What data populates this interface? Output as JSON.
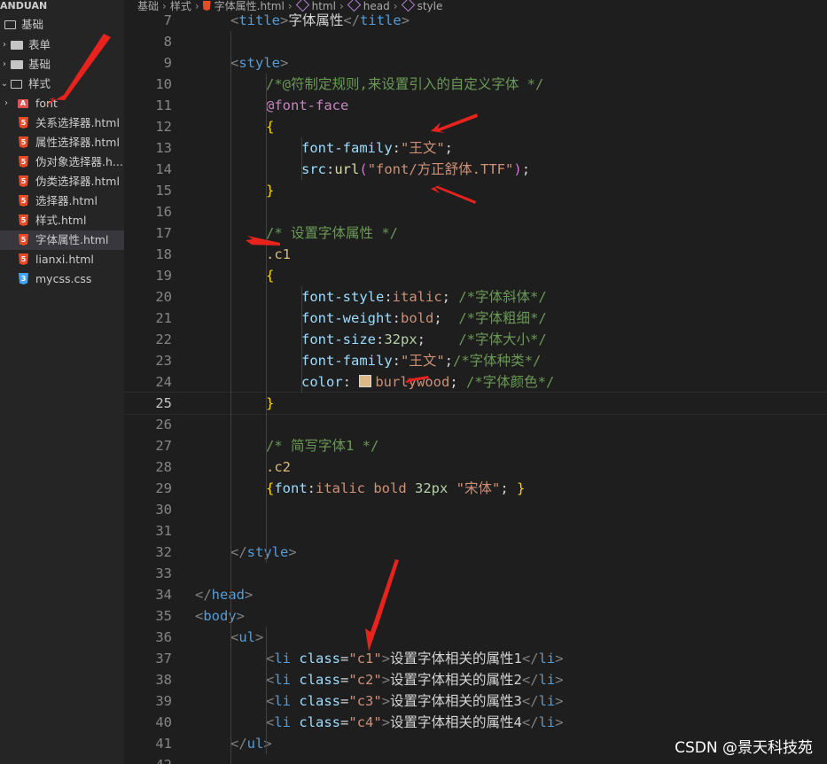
{
  "explorer": {
    "header": "ANDUAN",
    "items": [
      {
        "label": "基础",
        "kind": "folder-open",
        "indent": 0
      },
      {
        "label": "表单",
        "kind": "folder",
        "indent": 1
      },
      {
        "label": "基础",
        "kind": "folder",
        "indent": 1
      },
      {
        "label": "样式",
        "kind": "folder-open",
        "indent": 1
      },
      {
        "label": "font",
        "kind": "folder-font",
        "indent": 2
      },
      {
        "label": "关系选择器.html",
        "kind": "html",
        "indent": 2
      },
      {
        "label": "属性选择器.html",
        "kind": "html",
        "indent": 2
      },
      {
        "label": "伪对象选择器.h...",
        "kind": "html",
        "indent": 2
      },
      {
        "label": "伪类选择器.html",
        "kind": "html",
        "indent": 2
      },
      {
        "label": "选择器.html",
        "kind": "html",
        "indent": 2
      },
      {
        "label": "样式.html",
        "kind": "html",
        "indent": 2
      },
      {
        "label": "字体属性.html",
        "kind": "html",
        "indent": 2,
        "active": true
      },
      {
        "label": "lianxi.html",
        "kind": "html",
        "indent": 2
      },
      {
        "label": "mycss.css",
        "kind": "css",
        "indent": 2
      }
    ]
  },
  "breadcrumb": [
    "基础",
    "样式",
    "字体属性.html",
    "html",
    "head",
    "style"
  ],
  "editor": {
    "current_line": 25,
    "lines": [
      {
        "n": "7",
        "ind": 1,
        "t": [
          [
            "br",
            "<"
          ],
          [
            "tag",
            "title"
          ],
          [
            "br",
            ">"
          ],
          [
            "txt",
            "字体属性"
          ],
          [
            "br",
            "</"
          ],
          [
            "tag",
            "title"
          ],
          [
            "br",
            ">"
          ]
        ]
      },
      {
        "n": "8",
        "ind": 0,
        "t": []
      },
      {
        "n": "9",
        "ind": 1,
        "t": [
          [
            "br",
            "<"
          ],
          [
            "tag",
            "style"
          ],
          [
            "br",
            ">"
          ]
        ]
      },
      {
        "n": "10",
        "ind": 2,
        "t": [
          [
            "cm",
            "/*@符制定规则,来设置引入的自定义字体 */"
          ]
        ]
      },
      {
        "n": "11",
        "ind": 2,
        "t": [
          [
            "at",
            "@font-face"
          ]
        ]
      },
      {
        "n": "12",
        "ind": 2,
        "t": [
          [
            "b1",
            "{"
          ]
        ]
      },
      {
        "n": "13",
        "ind": 3,
        "t": [
          [
            "prop",
            "font-family"
          ],
          [
            "txt",
            ":"
          ],
          [
            "val",
            "\"王文\""
          ],
          [
            "txt",
            ";"
          ]
        ]
      },
      {
        "n": "14",
        "ind": 3,
        "t": [
          [
            "prop",
            "src"
          ],
          [
            "txt",
            ":"
          ],
          [
            "fn",
            "url"
          ],
          [
            "b2",
            "("
          ],
          [
            "val",
            "\"font/方正舒体.TTF\""
          ],
          [
            "b2",
            ")"
          ],
          [
            "txt",
            ";"
          ]
        ]
      },
      {
        "n": "15",
        "ind": 2,
        "t": [
          [
            "b1",
            "}"
          ]
        ]
      },
      {
        "n": "16",
        "ind": 0,
        "t": []
      },
      {
        "n": "17",
        "ind": 2,
        "t": [
          [
            "cm",
            "/* 设置字体属性 */"
          ]
        ]
      },
      {
        "n": "18",
        "ind": 2,
        "t": [
          [
            "sel",
            ".c1"
          ]
        ]
      },
      {
        "n": "19",
        "ind": 2,
        "t": [
          [
            "b1",
            "{"
          ]
        ]
      },
      {
        "n": "20",
        "ind": 3,
        "t": [
          [
            "prop",
            "font-style"
          ],
          [
            "txt",
            ":"
          ],
          [
            "val",
            "italic"
          ],
          [
            "txt",
            "; "
          ],
          [
            "cm",
            "/*字体斜体*/"
          ]
        ]
      },
      {
        "n": "21",
        "ind": 3,
        "t": [
          [
            "prop",
            "font-weight"
          ],
          [
            "txt",
            ":"
          ],
          [
            "val",
            "bold"
          ],
          [
            "txt",
            ";  "
          ],
          [
            "cm",
            "/*字体粗细*/"
          ]
        ]
      },
      {
        "n": "22",
        "ind": 3,
        "t": [
          [
            "prop",
            "font-size"
          ],
          [
            "txt",
            ":"
          ],
          [
            "num",
            "32px"
          ],
          [
            "txt",
            ";    "
          ],
          [
            "cm",
            "/*字体大小*/"
          ]
        ]
      },
      {
        "n": "23",
        "ind": 3,
        "t": [
          [
            "prop",
            "font-family"
          ],
          [
            "txt",
            ":"
          ],
          [
            "val",
            "\"王文\""
          ],
          [
            "txt",
            ";"
          ],
          [
            "cm",
            "/*字体种类*/"
          ]
        ]
      },
      {
        "n": "24",
        "ind": 3,
        "t": [
          [
            "prop",
            "color"
          ],
          [
            "txt",
            ": "
          ],
          [
            "swatch",
            "#deb887"
          ],
          [
            "val",
            "burlywood"
          ],
          [
            "txt",
            "; "
          ],
          [
            "cm",
            "/*字体颜色*/"
          ]
        ]
      },
      {
        "n": "25",
        "ind": 2,
        "t": [
          [
            "b1",
            "}"
          ]
        ]
      },
      {
        "n": "26",
        "ind": 0,
        "t": []
      },
      {
        "n": "27",
        "ind": 2,
        "t": [
          [
            "cm",
            "/* 简写字体1 */"
          ]
        ]
      },
      {
        "n": "28",
        "ind": 2,
        "t": [
          [
            "sel",
            ".c2"
          ]
        ]
      },
      {
        "n": "29",
        "ind": 2,
        "t": [
          [
            "b1",
            "{"
          ],
          [
            "prop",
            "font"
          ],
          [
            "txt",
            ":"
          ],
          [
            "val",
            "italic bold "
          ],
          [
            "num",
            "32px"
          ],
          [
            "txt",
            " "
          ],
          [
            "val",
            "\"宋体\""
          ],
          [
            "txt",
            "; "
          ],
          [
            "b1",
            "}"
          ]
        ]
      },
      {
        "n": "30",
        "ind": 0,
        "t": []
      },
      {
        "n": "31",
        "ind": 0,
        "t": []
      },
      {
        "n": "32",
        "ind": 1,
        "t": [
          [
            "br",
            "</"
          ],
          [
            "tag",
            "style"
          ],
          [
            "br",
            ">"
          ]
        ]
      },
      {
        "n": "33",
        "ind": 0,
        "t": []
      },
      {
        "n": "34",
        "ind": 0,
        "t": [
          [
            "br",
            "</"
          ],
          [
            "tag",
            "head"
          ],
          [
            "br",
            ">"
          ]
        ]
      },
      {
        "n": "35",
        "ind": 0,
        "t": [
          [
            "br",
            "<"
          ],
          [
            "tag",
            "body"
          ],
          [
            "br",
            ">"
          ]
        ]
      },
      {
        "n": "36",
        "ind": 1,
        "t": [
          [
            "br",
            "<"
          ],
          [
            "tag",
            "ul"
          ],
          [
            "br",
            ">"
          ]
        ]
      },
      {
        "n": "37",
        "ind": 2,
        "t": [
          [
            "br",
            "<"
          ],
          [
            "tag",
            "li"
          ],
          [
            "txt",
            " "
          ],
          [
            "attr",
            "class"
          ],
          [
            "txt",
            "="
          ],
          [
            "val",
            "\"c1\""
          ],
          [
            "br",
            ">"
          ],
          [
            "txt",
            "设置字体相关的属性1"
          ],
          [
            "br",
            "</"
          ],
          [
            "tag",
            "li"
          ],
          [
            "br",
            ">"
          ]
        ]
      },
      {
        "n": "38",
        "ind": 2,
        "t": [
          [
            "br",
            "<"
          ],
          [
            "tag",
            "li"
          ],
          [
            "txt",
            " "
          ],
          [
            "attr",
            "class"
          ],
          [
            "txt",
            "="
          ],
          [
            "val",
            "\"c2\""
          ],
          [
            "br",
            ">"
          ],
          [
            "txt",
            "设置字体相关的属性2"
          ],
          [
            "br",
            "</"
          ],
          [
            "tag",
            "li"
          ],
          [
            "br",
            ">"
          ]
        ]
      },
      {
        "n": "39",
        "ind": 2,
        "t": [
          [
            "br",
            "<"
          ],
          [
            "tag",
            "li"
          ],
          [
            "txt",
            " "
          ],
          [
            "attr",
            "class"
          ],
          [
            "txt",
            "="
          ],
          [
            "val",
            "\"c3\""
          ],
          [
            "br",
            ">"
          ],
          [
            "txt",
            "设置字体相关的属性3"
          ],
          [
            "br",
            "</"
          ],
          [
            "tag",
            "li"
          ],
          [
            "br",
            ">"
          ]
        ]
      },
      {
        "n": "40",
        "ind": 2,
        "t": [
          [
            "br",
            "<"
          ],
          [
            "tag",
            "li"
          ],
          [
            "txt",
            " "
          ],
          [
            "attr",
            "class"
          ],
          [
            "txt",
            "="
          ],
          [
            "val",
            "\"c4\""
          ],
          [
            "br",
            ">"
          ],
          [
            "txt",
            "设置字体相关的属性4"
          ],
          [
            "br",
            "</"
          ],
          [
            "tag",
            "li"
          ],
          [
            "br",
            ">"
          ]
        ]
      },
      {
        "n": "41",
        "ind": 1,
        "t": [
          [
            "br",
            "</"
          ],
          [
            "tag",
            "ul"
          ],
          [
            "br",
            ">"
          ]
        ]
      },
      {
        "n": "42",
        "ind": 0,
        "t": []
      }
    ]
  },
  "annotation_color": "#e8231e",
  "watermark": "CSDN @景天科技苑"
}
